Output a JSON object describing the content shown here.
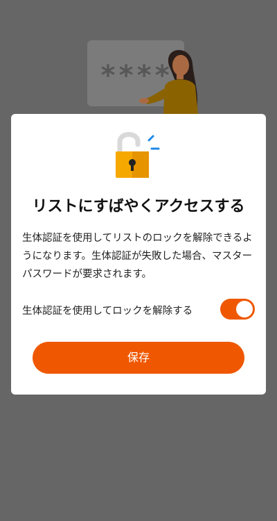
{
  "background": {
    "password_stars": "****"
  },
  "dialog": {
    "title": "リストにすばやくアクセスする",
    "description": "生体認証を使用してリストのロックを解除できるようになります。生体認証が失敗した場合、マスターパスワードが要求されます。",
    "toggle": {
      "label": "生体認証を使用してロックを解除する",
      "state": "on"
    },
    "save_label": "保存"
  },
  "colors": {
    "accent": "#ef5800",
    "overlay": "#666666",
    "lock_body": "#f5a800",
    "lock_shackle": "#d9d9d9",
    "sparkle": "#1e88e5"
  },
  "icons": {
    "lock": "unlocked-padlock-icon"
  }
}
